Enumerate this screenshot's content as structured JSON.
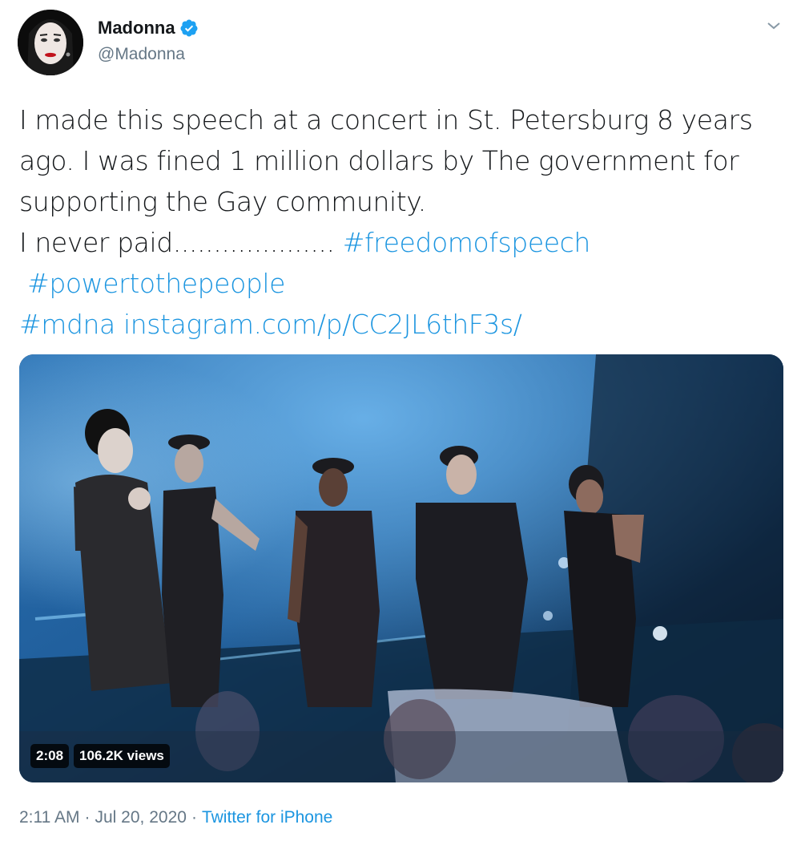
{
  "user": {
    "display_name": "Madonna",
    "handle": "@Madonna",
    "verified_icon": "verified-badge-icon",
    "avatar_icon": "profile-avatar"
  },
  "tweet": {
    "lines": [
      "I made this speech at a concert in St. Petersburg 8 years",
      "ago. I was fined 1 million dollars by The government for",
      "supporting the Gay community."
    ],
    "line4_text": "I never paid.................... ",
    "hashtag_1": "#freedomofspeech",
    "hashtag_2": "#powertothepeople",
    "hashtag_3": "#mdna",
    "url": "instagram.com/p/CC2JL6thF3s/"
  },
  "video": {
    "duration": "2:08",
    "views": "106.2K views"
  },
  "footer": {
    "time": "2:11 AM",
    "separator": "·",
    "date": "Jul 20, 2020",
    "source": "Twitter for iPhone"
  },
  "colors": {
    "link": "#1b95e0",
    "verified": "#1da1f2",
    "secondary_text": "#657786"
  }
}
